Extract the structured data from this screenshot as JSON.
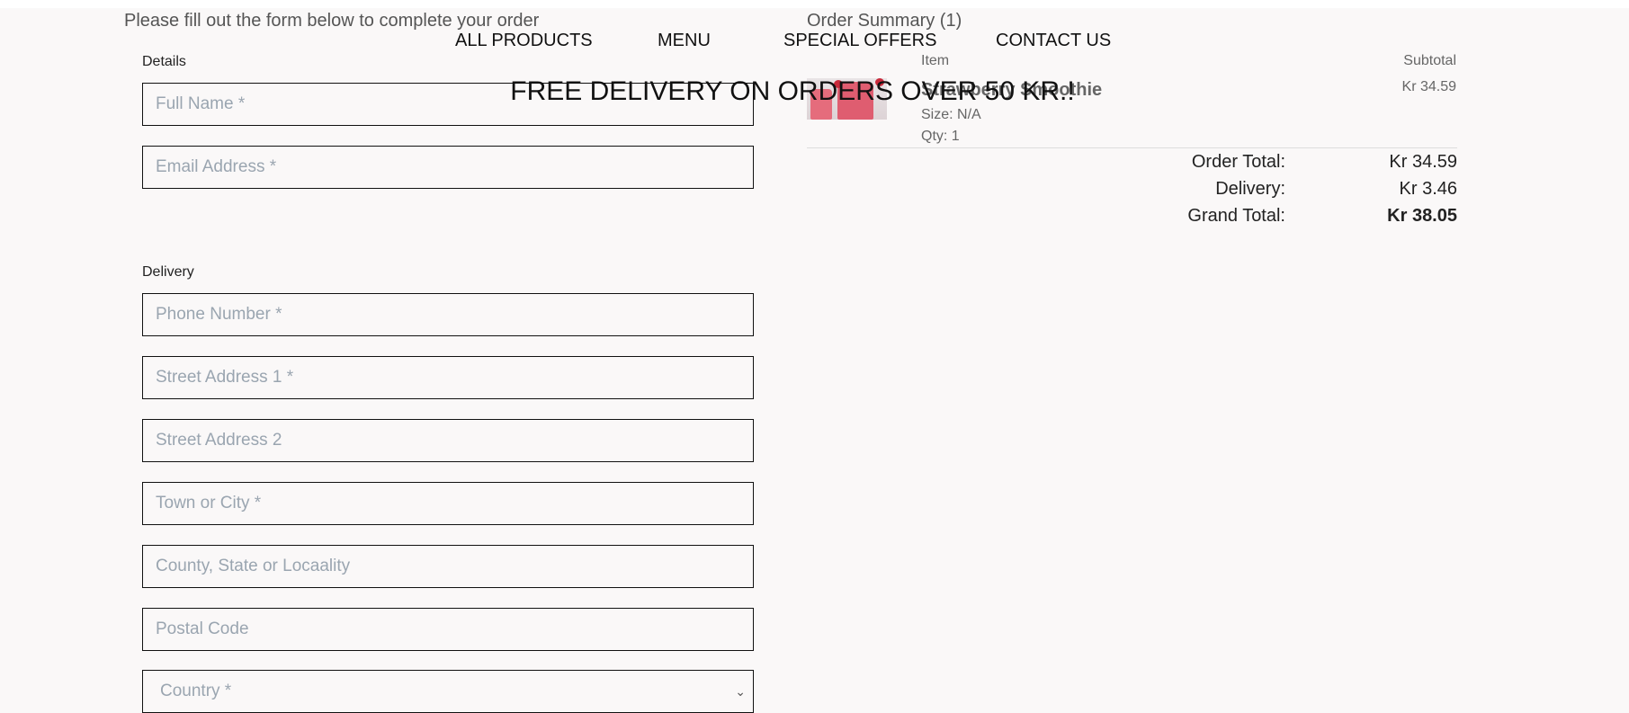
{
  "header": {
    "intro_text": "Please fill out the form below to complete your order",
    "summary_title": "Order Summary (1)"
  },
  "nav": {
    "items": [
      {
        "label": "ALL PRODUCTS"
      },
      {
        "label": "MENU"
      },
      {
        "label": "SPECIAL OFFERS"
      },
      {
        "label": "CONTACT US"
      }
    ]
  },
  "banner": {
    "text": "FREE DELIVERY ON ORDERS OVER 50 KR.!"
  },
  "form": {
    "details_label": "Details",
    "delivery_label": "Delivery",
    "fields": {
      "full_name": {
        "placeholder": "Full Name *",
        "value": ""
      },
      "email": {
        "placeholder": "Email Address *",
        "value": ""
      },
      "phone": {
        "placeholder": "Phone Number *",
        "value": ""
      },
      "street1": {
        "placeholder": "Street Address 1 *",
        "value": ""
      },
      "street2": {
        "placeholder": "Street Address 2",
        "value": ""
      },
      "town": {
        "placeholder": "Town or City *",
        "value": ""
      },
      "county": {
        "placeholder": "County, State or Locaality",
        "value": ""
      },
      "postal": {
        "placeholder": "Postal Code",
        "value": ""
      }
    },
    "country": {
      "selected": "Country *"
    }
  },
  "summary": {
    "item_header": "Item",
    "subtotal_header": "Subtotal",
    "item": {
      "name": "Strawberry Smoothie",
      "size": "Size: N/A",
      "qty": "Qty: 1",
      "subtotal": "Kr 34.59"
    },
    "totals": {
      "order_total_label": "Order Total:",
      "order_total_value": "Kr 34.59",
      "delivery_label": "Delivery:",
      "delivery_value": "Kr 3.46",
      "grand_total_label": "Grand Total:",
      "grand_total_value": "Kr 38.05"
    }
  },
  "icons": {
    "country_chevron": "chevron-down-icon"
  },
  "colors": {
    "background": "#faf8f8",
    "placeholder": "#9aa5b0",
    "border": "#111111"
  }
}
